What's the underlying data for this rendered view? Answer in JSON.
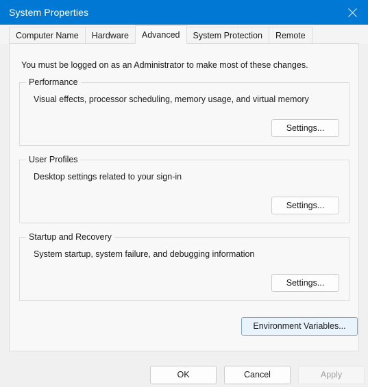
{
  "window": {
    "title": "System Properties",
    "close_icon": "close-icon",
    "accent_color": "#0078d4",
    "panel_bg": "#f8f8f8",
    "dialog_bg": "#f0f0f0"
  },
  "tabs": [
    {
      "label": "Computer Name",
      "selected": false
    },
    {
      "label": "Hardware",
      "selected": false
    },
    {
      "label": "Advanced",
      "selected": true
    },
    {
      "label": "System Protection",
      "selected": false
    },
    {
      "label": "Remote",
      "selected": false
    }
  ],
  "content": {
    "admin_note": "You must be logged on as an Administrator to make most of these changes.",
    "groups": [
      {
        "legend": "Performance",
        "description": "Visual effects, processor scheduling, memory usage, and virtual memory",
        "button_label": "Settings..."
      },
      {
        "legend": "User Profiles",
        "description": "Desktop settings related to your sign-in",
        "button_label": "Settings..."
      },
      {
        "legend": "Startup and Recovery",
        "description": "System startup, system failure, and debugging information",
        "button_label": "Settings..."
      }
    ],
    "environment_variables_button": {
      "label": "Environment Variables...",
      "focused": true,
      "focus_border_color": "#7aa7c7",
      "focus_fill_color": "#e9f3fb"
    }
  },
  "footer": {
    "ok_label": "OK",
    "cancel_label": "Cancel",
    "apply_label": "Apply",
    "apply_disabled": true
  }
}
